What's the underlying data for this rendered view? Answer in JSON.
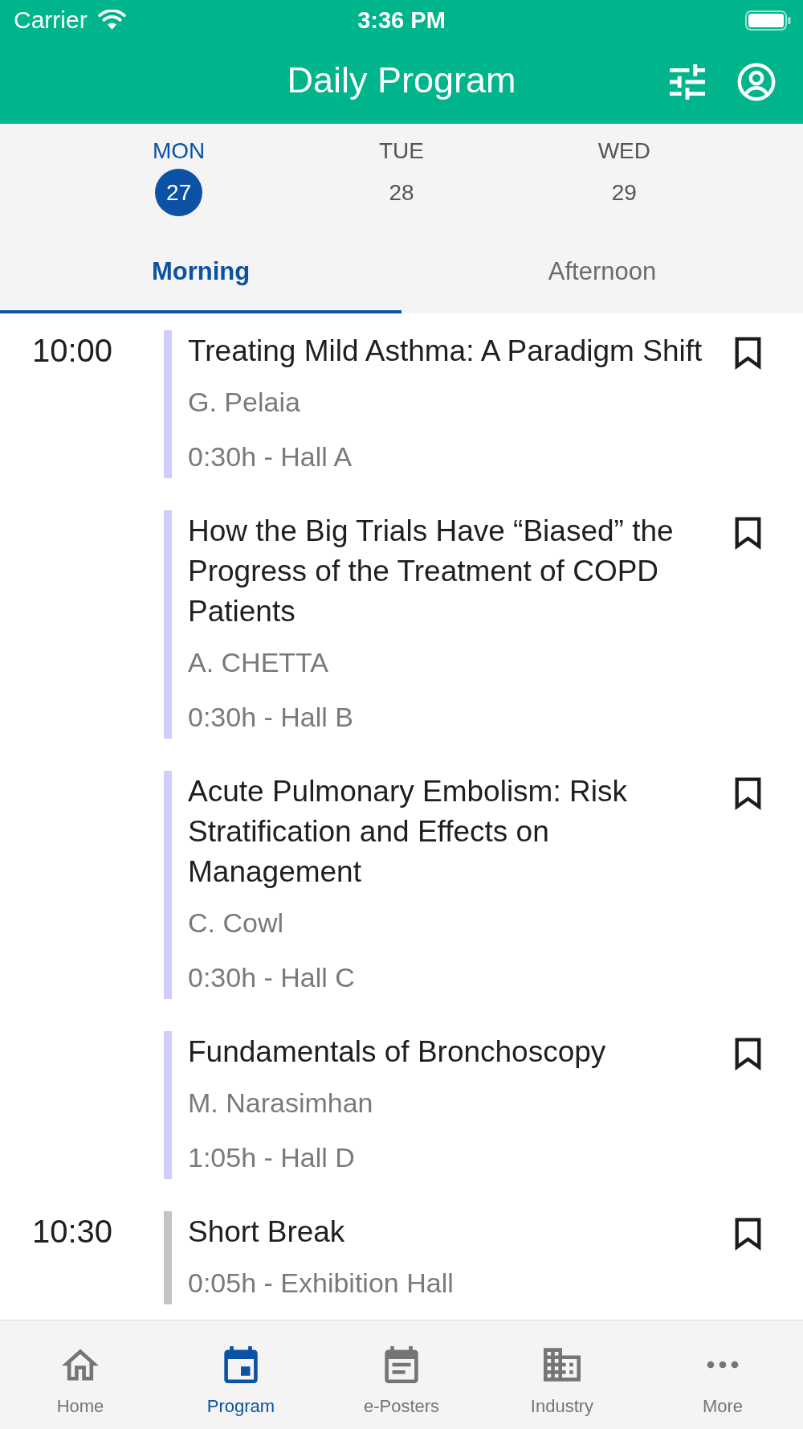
{
  "status_bar": {
    "carrier": "Carrier",
    "time": "3:36 PM"
  },
  "header": {
    "title": "Daily Program"
  },
  "days": [
    {
      "weekday": "MON",
      "date": "27",
      "selected": true
    },
    {
      "weekday": "TUE",
      "date": "28",
      "selected": false
    },
    {
      "weekday": "WED",
      "date": "29",
      "selected": false
    }
  ],
  "tabs": [
    {
      "label": "Morning",
      "selected": true
    },
    {
      "label": "Afternoon",
      "selected": false
    }
  ],
  "schedule": [
    {
      "time": "10:00",
      "sessions": [
        {
          "title": "Treating Mild Asthma: A Paradigm Shift",
          "speaker": "G. Pelaia",
          "details": "0:30h - Hall A",
          "color": "#cfcdfb",
          "bookmarked": false
        },
        {
          "title": "How the Big Trials Have “Biased” the Progress of the Treatment of COPD Patients",
          "speaker": "A. CHETTA",
          "details": "0:30h - Hall B",
          "color": "#cfcdfb",
          "bookmarked": false
        },
        {
          "title": "Acute Pulmonary Embolism: Risk Stratification and Effects on Management",
          "speaker": "C. Cowl",
          "details": "0:30h - Hall C",
          "color": "#cfcdfb",
          "bookmarked": false
        },
        {
          "title": "Fundamentals of Bronchoscopy",
          "speaker": "M. Narasimhan",
          "details": "1:05h - Hall D",
          "color": "#cfcdfb",
          "bookmarked": false
        }
      ]
    },
    {
      "time": "10:30",
      "sessions": [
        {
          "title": "Short Break",
          "details": "0:05h - Exhibition Hall",
          "color": "#c4c4c4",
          "bookmarked": false
        }
      ]
    }
  ],
  "bottom_nav": [
    {
      "label": "Home",
      "selected": false
    },
    {
      "label": "Program",
      "selected": true
    },
    {
      "label": "e-Posters",
      "selected": false
    },
    {
      "label": "Industry",
      "selected": false
    },
    {
      "label": "More",
      "selected": false
    }
  ]
}
